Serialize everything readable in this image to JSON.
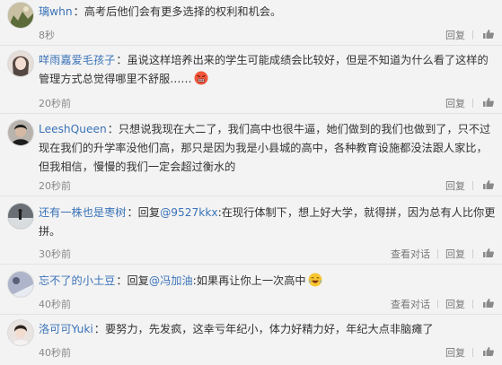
{
  "comments": [
    {
      "author": "璃whn",
      "text": "：高考后他们会有更多选择的权利和机会。",
      "time": "8秒",
      "reply": "回复"
    },
    {
      "author": "咩雨嘉爱毛孩子",
      "text": "：虽说这样培养出来的学生可能成绩会比较好，但是不知道为什么看了这样的管理方式总觉得哪里不舒服……",
      "emoji": "angry-face-emoji",
      "time": "20秒前",
      "reply": "回复"
    },
    {
      "author": "LeeshQueen",
      "text": "：只想说我现在大二了，我们高中也很牛逼，她们做到的我们也做到了，只不过现在我们的升学率没他们高，那只是因为我是小县城的高中，各种教育设施都没法跟人家比，但我相信，慢慢的我们一定会超过衡水的",
      "time": "20秒前",
      "reply": "回复"
    },
    {
      "author": "还有一株也是枣树",
      "text_before": "：回复",
      "mention": "@9527kkx",
      "text_after": ":在现行体制下，想上好大学，就得拼，因为总有人比你更拼。",
      "time": "30秒前",
      "view_dialog": "查看对话",
      "reply": "回复"
    },
    {
      "author": "忘不了的小土豆",
      "text_before": "：回复",
      "mention": "@冯加油",
      "text_after": ":如果再让你上一次高中",
      "emoji": "laughing-tears-emoji",
      "time": "40秒前",
      "view_dialog": "查看对话",
      "reply": "回复"
    },
    {
      "author": "洛可可Yuki",
      "text": "：要努力，先发疯，这幸亏年纪小，体力好精力好，年纪大点非脑瘫了",
      "time": "40秒前",
      "reply": "回复"
    }
  ],
  "colors": {
    "author_orange": "#eb7350",
    "link_blue": "#3b73b9",
    "meta_gray": "#888888",
    "background": "#f3f3f3"
  }
}
